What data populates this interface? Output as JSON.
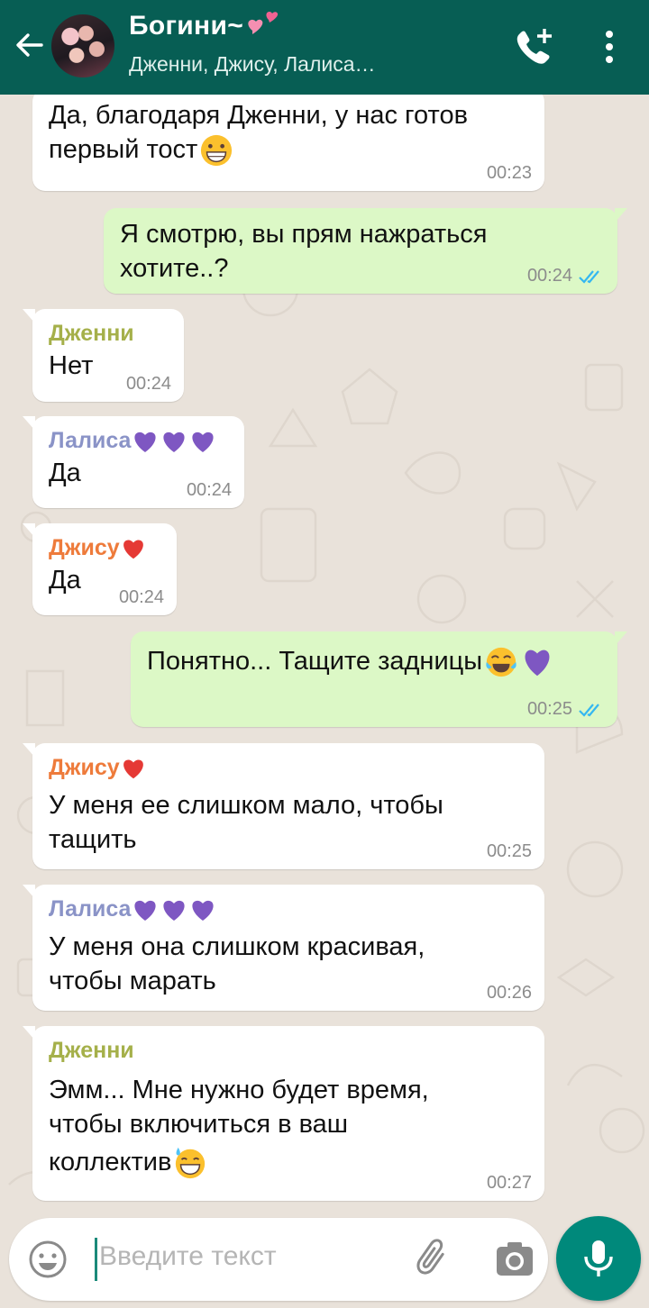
{
  "header": {
    "title": "Богини~",
    "subtitle": "Дженни, Джису, Лалиса…",
    "colors": {
      "bar": "#075e54"
    }
  },
  "messages": [
    {
      "direction": "in",
      "sender": "",
      "text_lines": [
        "Да, благодаря Дженни, у нас готов",
        "первый тост"
      ],
      "emoji": "grinning-face",
      "time": "00:23"
    },
    {
      "direction": "out",
      "text_lines": [
        "Я смотрю, вы прям нажраться",
        "хотите..?"
      ],
      "time": "00:24",
      "status": "read"
    },
    {
      "direction": "in",
      "sender": "Дженни",
      "sender_color": "#a5b04a",
      "text_lines": [
        "Нет"
      ],
      "time": "00:24"
    },
    {
      "direction": "in",
      "sender": "Лалиса",
      "sender_color": "#8a93c7",
      "sender_emoji": [
        "purple-heart",
        "purple-heart",
        "purple-heart"
      ],
      "text_lines": [
        "Да"
      ],
      "time": "00:24"
    },
    {
      "direction": "in",
      "sender": "Джису",
      "sender_color": "#ee7b3b",
      "sender_emoji": [
        "red-heart"
      ],
      "text_lines": [
        "Да"
      ],
      "time": "00:24"
    },
    {
      "direction": "out",
      "text_lines": [
        "Понятно... Тащите задницы"
      ],
      "emoji": "tears-of-joy + purple-heart",
      "time": "00:25",
      "status": "read"
    },
    {
      "direction": "in",
      "sender": "Джису",
      "sender_color": "#ee7b3b",
      "sender_emoji": [
        "red-heart"
      ],
      "text_lines": [
        "У меня ее слишком мало, чтобы",
        "тащить"
      ],
      "time": "00:25"
    },
    {
      "direction": "in",
      "sender": "Лалиса",
      "sender_color": "#8a93c7",
      "sender_emoji": [
        "purple-heart",
        "purple-heart",
        "purple-heart"
      ],
      "text_lines": [
        "У меня она слишком красивая,",
        "чтобы марать"
      ],
      "time": "00:26"
    },
    {
      "direction": "in",
      "sender": "Дженни",
      "sender_color": "#a5b04a",
      "text_lines": [
        "Эмм... Мне нужно будет время,",
        "чтобы включиться в ваш",
        "коллектив"
      ],
      "emoji": "grinning-sweat",
      "time": "00:27"
    }
  ],
  "input": {
    "placeholder": "Введите текст"
  },
  "icons": {
    "back": "arrow-left-icon",
    "call": "add-call-icon",
    "menu": "more-vert-icon",
    "emoji": "emoji-icon",
    "attach": "paperclip-icon",
    "camera": "camera-icon",
    "mic": "mic-icon"
  }
}
